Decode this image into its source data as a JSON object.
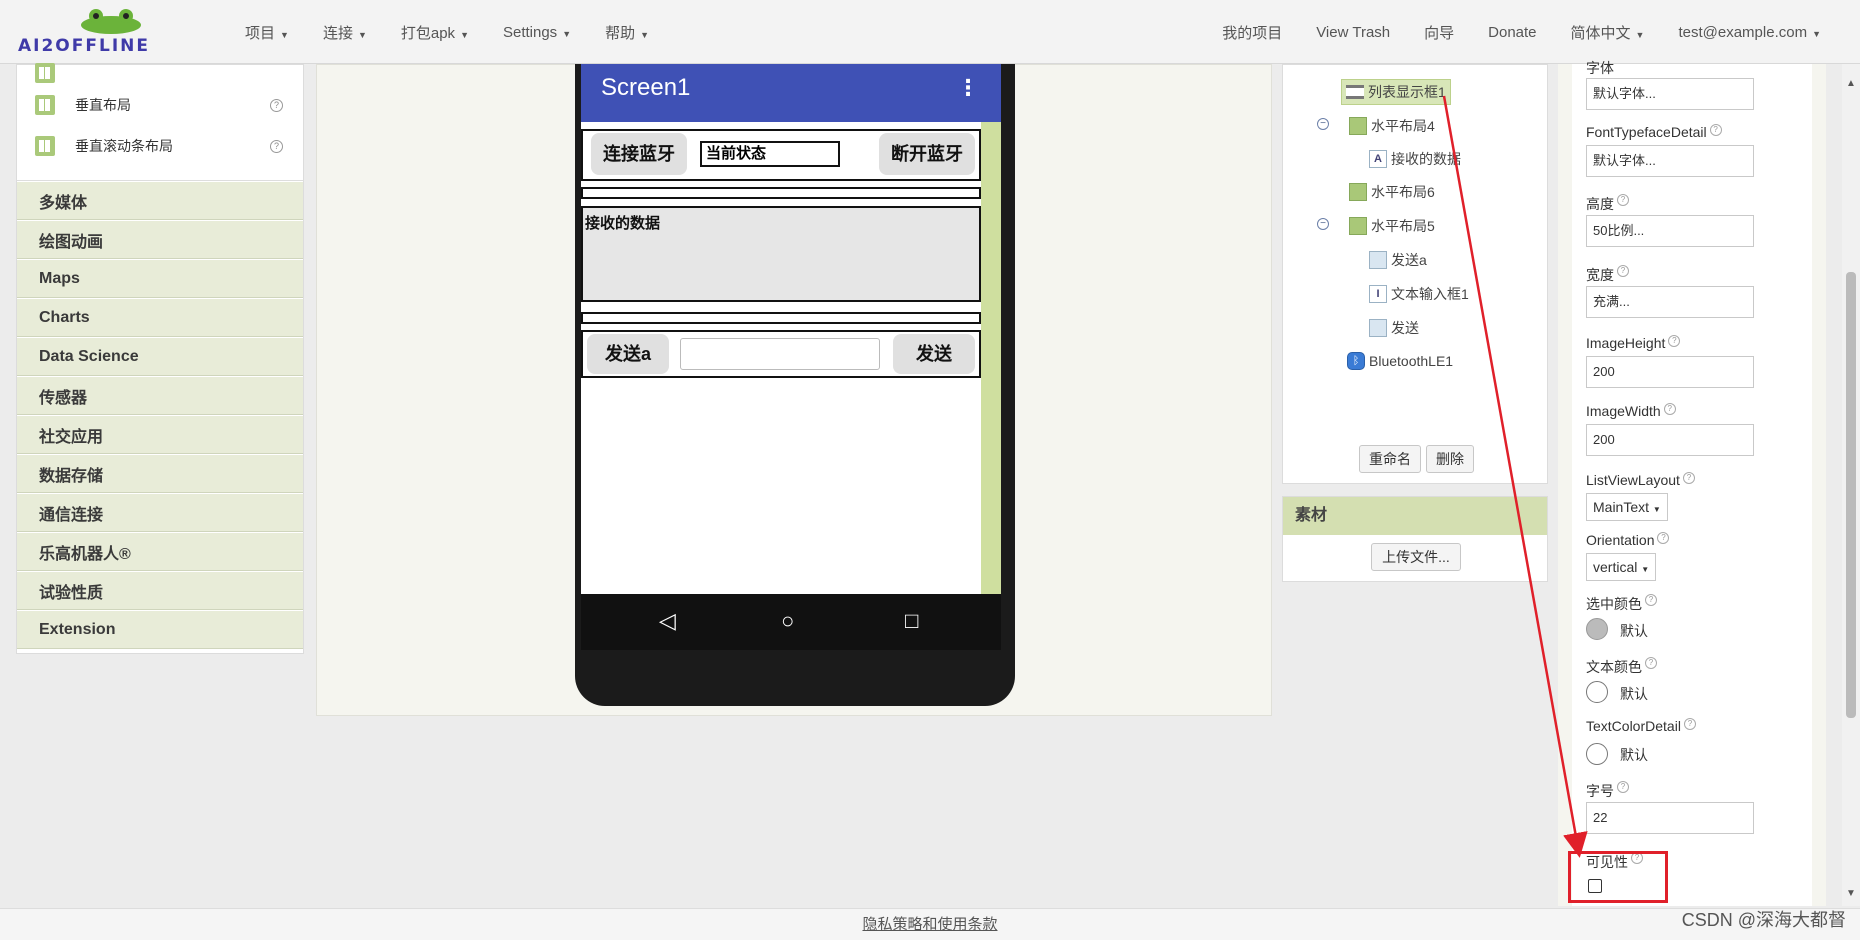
{
  "topbar": {
    "logo_text": "AI2OFFLINE",
    "nav_left": [
      "项目",
      "连接",
      "打包apk",
      "Settings",
      "帮助"
    ],
    "nav_right": [
      "我的项目",
      "View Trash",
      "向导",
      "Donate",
      "简体中文",
      "test@example.com"
    ]
  },
  "palette": {
    "items": [
      "垂直布局",
      "垂直滚动条布局"
    ],
    "categories": [
      "多媒体",
      "绘图动画",
      "Maps",
      "Charts",
      "Data Science",
      "传感器",
      "社交应用",
      "数据存储",
      "通信连接",
      "乐高机器人®",
      "试验性质",
      "Extension"
    ]
  },
  "phone": {
    "title": "Screen1",
    "connect_btn": "连接蓝牙",
    "status_text": "当前状态",
    "disconnect_btn": "断开蓝牙",
    "received_label": "接收的数据",
    "send_a_btn": "发送a",
    "send_btn": "发送"
  },
  "tree": {
    "nodes": [
      "列表显示框1",
      "水平布局4",
      "接收的数据",
      "水平布局6",
      "水平布局5",
      "发送a",
      "文本输入框1",
      "发送",
      "BluetoothLE1"
    ],
    "rename": "重命名",
    "delete": "删除"
  },
  "assets": {
    "title": "素材",
    "upload": "上传文件..."
  },
  "props": {
    "font_label": "字体",
    "font_value": "默认字体...",
    "typeface_detail_label": "FontTypefaceDetail",
    "typeface_detail_value": "默认字体...",
    "height_label": "高度",
    "height_value": "50比例...",
    "width_label": "宽度",
    "width_value": "充满...",
    "image_height_label": "ImageHeight",
    "image_height_value": "200",
    "image_width_label": "ImageWidth",
    "image_width_value": "200",
    "listview_layout_label": "ListViewLayout",
    "listview_layout_value": "MainText",
    "orientation_label": "Orientation",
    "orientation_value": "vertical",
    "selection_color_label": "选中颜色",
    "selection_color_value": "默认",
    "text_color_label": "文本颜色",
    "text_color_value": "默认",
    "text_color_detail_label": "TextColorDetail",
    "text_color_detail_value": "默认",
    "font_size_label": "字号",
    "font_size_value": "22",
    "visible_label": "可见性",
    "visible_checked": false
  },
  "footer": {
    "link": "隐私策略和使用条款",
    "watermark": "CSDN @深海大都督"
  },
  "colors": {
    "accent": "#3f51b5",
    "highlight": "#e0202a",
    "category_bg": "#e8ecd8"
  }
}
